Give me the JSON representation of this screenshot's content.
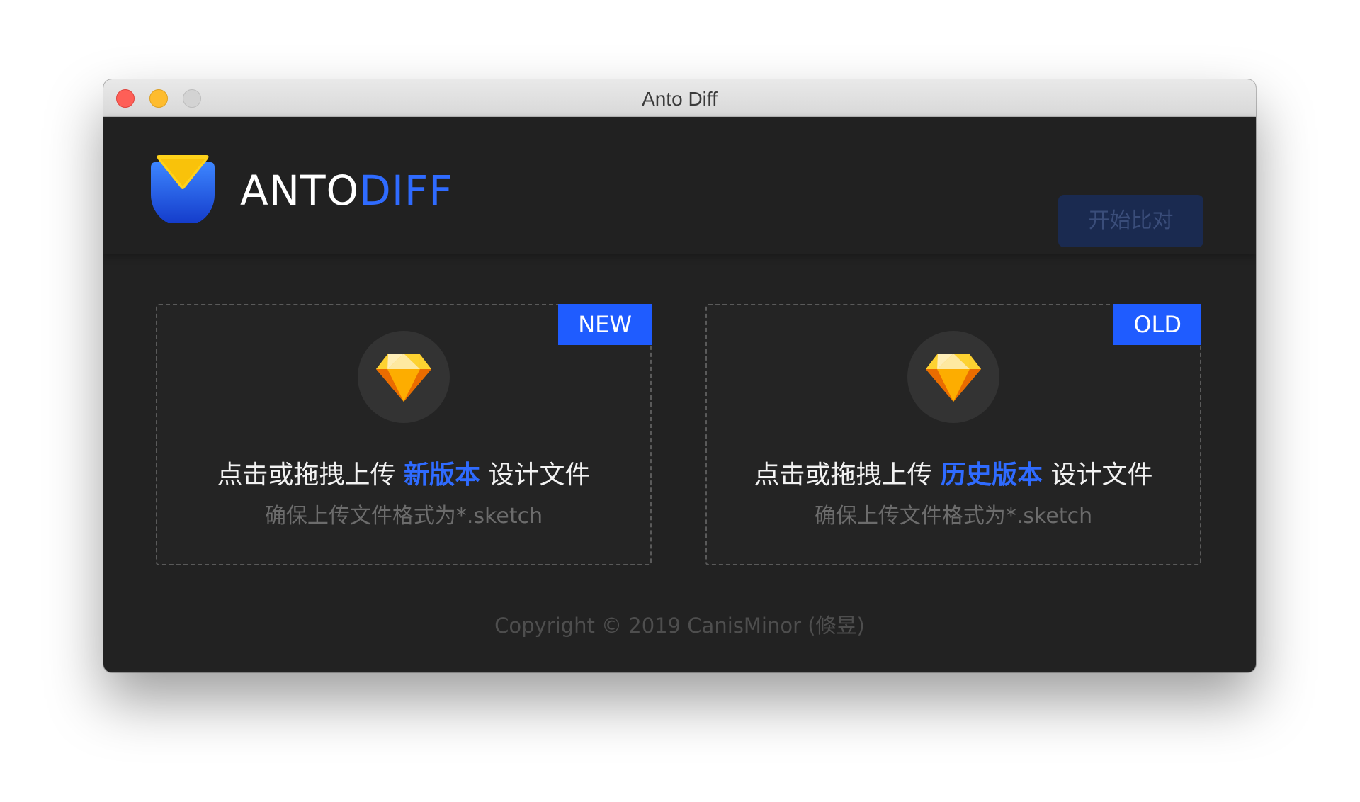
{
  "window": {
    "title": "Anto Diff"
  },
  "header": {
    "brand_primary": "ANTO",
    "brand_secondary": "DIFF",
    "start_button": "开始比对"
  },
  "dropzones": [
    {
      "badge": "NEW",
      "prefix": "点击或拖拽上传 ",
      "highlight": "新版本",
      "suffix": " 设计文件",
      "hint": "确保上传文件格式为*.sketch"
    },
    {
      "badge": "OLD",
      "prefix": "点击或拖拽上传 ",
      "highlight": "历史版本",
      "suffix": " 设计文件",
      "hint": "确保上传文件格式为*.sketch"
    }
  ],
  "footer": {
    "copyright": "Copyright © 2019 CanisMinor (倏昱)"
  },
  "colors": {
    "accent": "#2f6bff",
    "badge": "#1f5cff",
    "background": "#222222"
  },
  "icons": {
    "logo": "anto-logo-icon",
    "sketch": "sketch-diamond-icon"
  }
}
